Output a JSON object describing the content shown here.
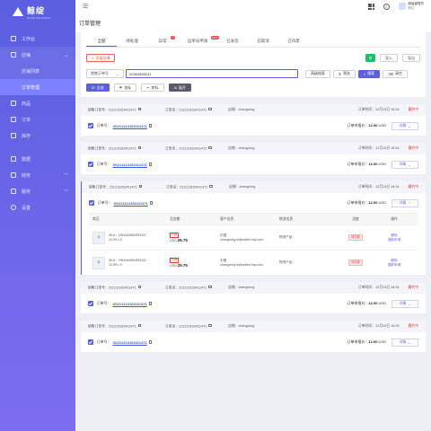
{
  "brand": {
    "title": "鲸绽",
    "subtitle": "WHALESHOPS"
  },
  "sidebar": {
    "items": [
      {
        "label": "工作台"
      },
      {
        "label": "店铺"
      },
      {
        "label": "店铺列表"
      },
      {
        "label": "订单管理"
      },
      {
        "label": "商品"
      },
      {
        "label": "订单"
      },
      {
        "label": "库存"
      },
      {
        "label": "数据"
      },
      {
        "label": "财务"
      },
      {
        "label": "服务"
      },
      {
        "label": "设置"
      }
    ]
  },
  "topbar": {
    "user_name": "超级管理员",
    "user_role": "职位"
  },
  "page": {
    "title": "订单管理"
  },
  "tabs": [
    {
      "label": "全部",
      "badge": ""
    },
    {
      "label": "待处理",
      "badge": ""
    },
    {
      "label": "异常",
      "badge": "6"
    },
    {
      "label": "运单号申请",
      "badge": "2223"
    },
    {
      "label": "已发货",
      "badge": ""
    },
    {
      "label": "已取消",
      "badge": ""
    },
    {
      "label": "已作废",
      "badge": ""
    }
  ],
  "toolbar": {
    "add_label": "添加店铺",
    "import_label": "导入",
    "export_label": "导出",
    "search_type": "销售订单号",
    "search_value": "20454555231",
    "advanced_label": "高级搜索",
    "filter_label": "筛选",
    "search_label": "搜索",
    "clear_label": "清空",
    "select_all_label": "全选",
    "flag_label": "加标",
    "cut_label": "剪标",
    "expand_label": "展开"
  },
  "orders": [
    {
      "sales_no_label": "销售订单号：",
      "sales_no": "211213163411471",
      "order_name_label": "订单名：",
      "order_name": "211213163411471",
      "store_label": "店铺：",
      "store": "changrong",
      "order_time_label": "订单时间：",
      "order_time": "12月13日 16:34",
      "status": "履约中",
      "order_no_label": "订单号：",
      "order_no": "XS211213163411471",
      "amount_label": "订单申报价：",
      "amount": "12.00",
      "currency": "USD",
      "detail_label": "详情"
    },
    {
      "sales_no_label": "销售订单号：",
      "sales_no": "211213163411471",
      "order_name_label": "订单名：",
      "order_name": "211213163411471",
      "store_label": "店铺：",
      "store": "changrong",
      "order_time_label": "订单时间：",
      "order_time": "12月13日 16:34",
      "status": "履约中",
      "order_no_label": "订单号：",
      "order_no": "XS211213163411471",
      "amount_label": "订单申报价：",
      "amount": "12.00",
      "currency": "USD",
      "detail_label": "详情"
    },
    {
      "sales_no_label": "销售订单号：",
      "sales_no": "211213163411471",
      "order_name_label": "订单名：",
      "order_name": "211213163411471",
      "store_label": "店铺：",
      "store": "changrong",
      "order_time_label": "订单时间：",
      "order_time": "12月13日 16:34",
      "status": "履约中",
      "order_no_label": "订单号：",
      "order_no": "XS211213163411471",
      "amount_label": "订单申报价：",
      "amount": "12.00",
      "currency": "USD",
      "detail_label": "详情"
    },
    {
      "sales_no_label": "销售订单号：",
      "sales_no": "211213163411471",
      "order_name_label": "订单名：",
      "order_name": "211213163411471",
      "store_label": "店铺：",
      "store": "changrong",
      "order_time_label": "订单时间：",
      "order_time": "12月13日 16:34",
      "status": "履约中",
      "order_no_label": "订单号：",
      "order_no": "XS211213163411471",
      "amount_label": "订单申报价：",
      "amount": "12.00",
      "currency": "USD",
      "detail_label": "详情"
    },
    {
      "sales_no_label": "销售订单号：",
      "sales_no": "211213163411471",
      "order_name_label": "订单名：",
      "order_name": "211213163411471",
      "store_label": "店铺：",
      "store": "changrong",
      "order_time_label": "订单时间：",
      "order_time": "12月13日 16:34",
      "status": "履约中",
      "order_no_label": "订单号：",
      "order_no": "XS211213163411471",
      "amount_label": "订单申报价：",
      "amount": "12.00",
      "currency": "USD",
      "detail_label": "详情"
    }
  ],
  "items_table": {
    "headers": [
      "商品",
      "总金额",
      "客户信息",
      "物流信息",
      "进度",
      "操作"
    ],
    "rows": [
      {
        "sku": "SKU：HN1164551RED2Z",
        "qty": "12.99 x 3",
        "price_tag": "价格",
        "currency": "USD",
        "price": "29.75",
        "country": "中国",
        "email": "changrong.le@wales hop.com",
        "logistics": "物流产品：",
        "status": "待付款",
        "ops": [
          "删除",
          "退款申请"
        ]
      },
      {
        "sku": "SKU：HN1164551RED2Z",
        "qty": "12.99 x 3",
        "price_tag": "价格",
        "currency": "USD",
        "price": "29.75",
        "country": "中国",
        "email": "changrong.le@wales hop.com",
        "logistics": "物流产品：",
        "status": "待付款",
        "ops": [
          "删除",
          "退款申请"
        ]
      }
    ]
  },
  "colors": {
    "accent": "#5b5fe0",
    "status_red": "#e53935",
    "success": "#29b96a"
  }
}
